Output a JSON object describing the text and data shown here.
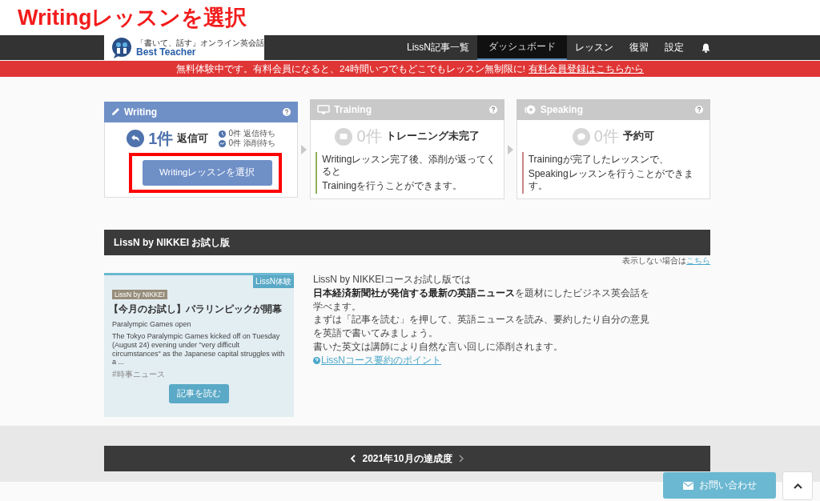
{
  "annotation": {
    "title": "Writingレッスンを選択"
  },
  "header": {
    "logo_tagline": "「書いて、話す」オンライン英会話",
    "logo_name": "Best Teacher",
    "nav": [
      {
        "label": "LissN記事一覧",
        "selected": false
      },
      {
        "label": "ダッシュボード",
        "selected": true
      },
      {
        "label": "レッスン",
        "selected": false
      },
      {
        "label": "復習",
        "selected": false
      },
      {
        "label": "設定",
        "selected": false
      }
    ]
  },
  "banner": {
    "text": "無料体験中です。有料会員になると、24時間いつでもどこでもレッスン無制限に!",
    "link": "有料会員登録はこちらから"
  },
  "steps": [
    {
      "kind": "writing",
      "title": "Writing",
      "active": true,
      "count": "1件",
      "status": "返信可",
      "sub": [
        {
          "count": "0件",
          "label": "返信待ち"
        },
        {
          "count": "0件",
          "label": "添削待ち"
        }
      ],
      "button": "Writingレッスンを選択",
      "highlighted": true
    },
    {
      "kind": "training",
      "title": "Training",
      "active": false,
      "count": "0件",
      "status": "トレーニング未完了",
      "note": [
        "Writingレッスン完了後、添削が返ってくると",
        "Trainingを行うことができます。"
      ],
      "color": "#8db255"
    },
    {
      "kind": "speaking",
      "title": "Speaking",
      "active": false,
      "count": "0件",
      "status": "予約可",
      "note": [
        "Trainingが完了したレッスンで、",
        "Speakingレッスンを行うことができます。"
      ],
      "color": "#c98585"
    }
  ],
  "lissn": {
    "title": "LissN by NIKKEI お試し版",
    "hide_note": "表示しない場合は",
    "hide_link": "こちら",
    "card": {
      "badge": "LissN体験",
      "source": "LissN by NIKKEI",
      "headline": "【今月のお試し】パラリンピックが開幕",
      "subtitle": "Paralympic Games open",
      "summary": "The Tokyo Paralympic Games kicked off on Tuesday (August 24) evening under \"very difficult circumstances\" as the Japanese capital struggles with a ...",
      "tag": "#時事ニュース",
      "button": "記事を読む"
    },
    "description": [
      "LissN by NIKKEIコースお試し版では",
      "**日本経済新聞社が発信する最新の英語ニュース**を題材にしたビジネス英会話を学べます。",
      "まずは「記事を読む」を押して、英語ニュースを読み、要約したり自分の意見を英語で書いてみましょう。",
      "書いた英文は講師により自然な言い回しに添削されます。"
    ],
    "link": "LissNコース要約のポイント"
  },
  "achievement": {
    "title": "2021年10月の達成度"
  },
  "contact_button": "お問い合わせ"
}
